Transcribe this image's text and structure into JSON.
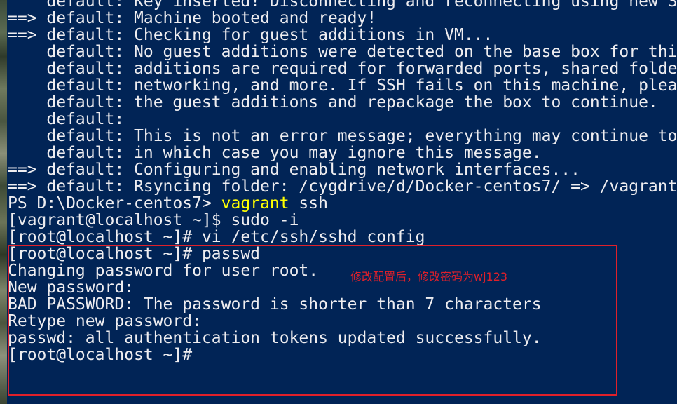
{
  "terminal": {
    "lines": [
      "    default: Key inserted! Disconnecting and reconnecting using new SSH key...",
      "==> default: Machine booted and ready!",
      "==> default: Checking for guest additions in VM...",
      "    default: No guest additions were detected on the base box for this VM! Guest",
      "    default: additions are required for forwarded ports, shared folders, host only",
      "    default: networking, and more. If SSH fails on this machine, please install",
      "    default: the guest additions and repackage the box to continue.",
      "    default:",
      "    default: This is not an error message; everything may continue to work properly,",
      "    default: in which case you may ignore this message.",
      "==> default: Configuring and enabling network interfaces...",
      "==> default: Rsyncing folder: /cygdrive/d/Docker-centos7/ => /vagrant"
    ],
    "ps_prompt": "PS D:\\Docker-centos7> ",
    "ps_command": "vagrant",
    "ps_args": " ssh",
    "lines_after": [
      "[vagrant@localhost ~]$ sudo -i",
      "[root@localhost ~]# vi /etc/ssh/sshd_config",
      "[root@localhost ~]# passwd",
      "Changing password for user root.",
      "New password:",
      "BAD PASSWORD: The password is shorter than 7 characters",
      "Retype new password:",
      "passwd: all authentication tokens updated successfully.",
      "[root@localhost ~]#"
    ]
  },
  "annotation": {
    "text": "修改配置后，修改密码为wj123",
    "color": "#e0202a"
  },
  "colors": {
    "background": "#012456",
    "foreground": "#eeedf0",
    "command": "#ffff00",
    "highlight": "#e0202a"
  }
}
